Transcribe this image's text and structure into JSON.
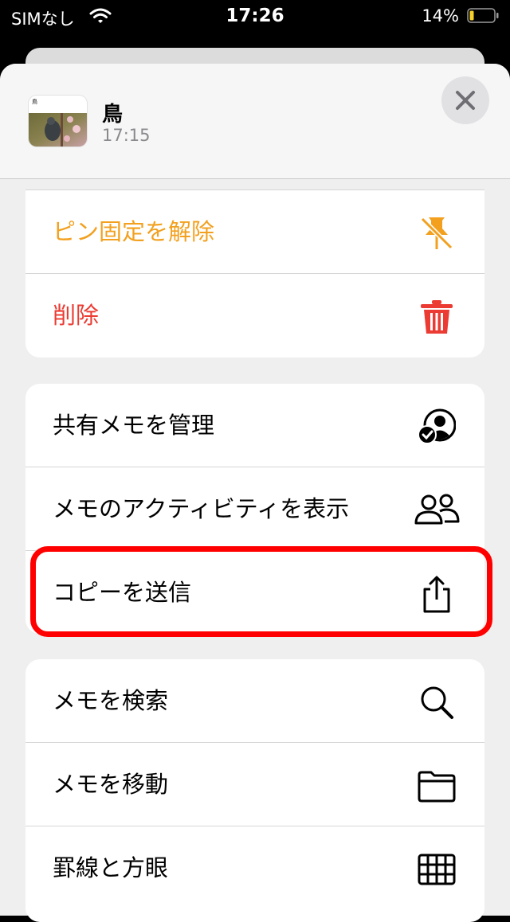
{
  "status_bar": {
    "carrier": "SIMなし",
    "time": "17:26",
    "battery": "14%"
  },
  "note": {
    "title": "鳥",
    "time": "17:15",
    "thumb_title": "鳥"
  },
  "group1": {
    "items": [
      {
        "label": "ピン固定を解除",
        "icon": "unpin-icon",
        "color": "#f2a01e"
      },
      {
        "label": "削除",
        "icon": "trash-icon",
        "color": "#eb3b32"
      }
    ]
  },
  "group2": {
    "items": [
      {
        "label": "共有メモを管理",
        "icon": "person-checkmark-icon"
      },
      {
        "label": "メモのアクティビティを表示",
        "icon": "two-people-icon"
      },
      {
        "label": "コピーを送信",
        "icon": "share-icon"
      }
    ]
  },
  "group3": {
    "items": [
      {
        "label": "メモを検索",
        "icon": "search-icon"
      },
      {
        "label": "メモを移動",
        "icon": "folder-icon"
      },
      {
        "label": "罫線と方眼",
        "icon": "grid-icon"
      }
    ]
  }
}
